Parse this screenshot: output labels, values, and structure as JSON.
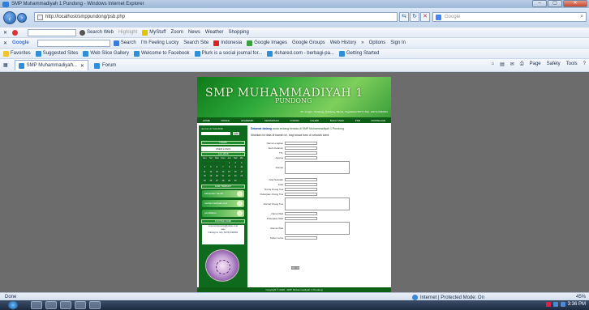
{
  "window": {
    "title": "SMP Muhammadiyah 1 Pundong - Windows Internet Explorer",
    "buttons": [
      "–",
      "▢",
      "✕"
    ]
  },
  "address": {
    "url": "http://localhost/smppundong/psb.php",
    "search_placeholder": "Google"
  },
  "toolbar1": {
    "items": [
      "Search Web",
      "Highlight",
      "MyStuff",
      "Zoom",
      "News",
      "Weather",
      "Shopping"
    ]
  },
  "toolbar2": {
    "brand": "Google",
    "items": [
      "Search",
      "I'm Feeling Lucky",
      "Search Site",
      "Indonesia",
      "Google Images",
      "Google Groups",
      "Web History",
      "»",
      "Options",
      "Sign In"
    ]
  },
  "favorites": {
    "label": "Favorites",
    "items": [
      "Suggested Sites",
      "Web Slice Gallery",
      "Welcome to Facebook",
      "Plurk is a social journal for...",
      "4shared.com - berbagi-pa...",
      "Getting Started"
    ]
  },
  "tabs": [
    {
      "label": "SMP Muhammadiyah..."
    },
    {
      "label": "Forum"
    }
  ],
  "commands": [
    "Page",
    "Safety",
    "Tools"
  ],
  "site": {
    "title": "SMP MUHAMMADIYAH 1",
    "subtitle": "PUNDONG",
    "address": "Jln. Imogiri - Pundong, Pundong, Bantul, Yogyakarta 55771 Telp. (0274) 6462301",
    "menu": [
      "HOME",
      "PROFIL",
      "AKADEMIK",
      "KESISWAAN",
      "FORUM",
      "GALERI",
      "BUKU TAMU",
      "PSB",
      "DOWNLOAD"
    ],
    "left": {
      "date": "Jum'at, 27 Juli 2018",
      "go": "GO",
      "login_head": "LOGIN",
      "login_box": "USER LOGIN",
      "calendar_head": "Juni 2018",
      "calendar": [
        "Sen",
        "Sel",
        "Rab",
        "Kam",
        "Jum",
        "Sab",
        "Min",
        "",
        "",
        "",
        "",
        "1",
        "2",
        "3",
        "4",
        "5",
        "6",
        "7",
        "8",
        "9",
        "10",
        "11",
        "12",
        "13",
        "14",
        "15",
        "16",
        "17",
        "18",
        "19",
        "20",
        "21",
        "22",
        "23",
        "24",
        "25",
        "26",
        "27",
        "28",
        "29",
        "30"
      ],
      "links_head": "LINK TERKAIT",
      "banners": [
        "kabupaten bantul",
        "muhammadiyah.or.id",
        "pendidikan"
      ],
      "contact_head": "KONTAK KAMI",
      "contact_lines": [
        "smpmuh1pundong@yahoo.co.id",
        "atau",
        "hubungi no. telp. (0274) 6462301"
      ]
    },
    "content": {
      "welcome_prefix": "Selamat datang",
      "welcome_rest": "anda sedang berada di SMP Muhammadiyah 1 Pundong",
      "intro": "Silahkan isi data di bawah ini, bagi siswa baru di sekolah kami",
      "fields": [
        "Nama Lengkap",
        "Jenis Kelamin",
        "TTL",
        "Agama",
        "Alamat",
        "Asal Sekolah",
        "Kota",
        "Nama Orang Tua",
        "Pekerjaan Orang Tua",
        "Alamat Orang Tua",
        "Nama Wali",
        "Pekerjaan Wali",
        "Alamat Wali",
        "Tahun Lulus"
      ],
      "submit": "KIRIM"
    },
    "footer": "Copyright © 2018 - SMP Muhammadiyah 1 Pundong"
  },
  "status": {
    "done": "Done",
    "zone": "Internet | Protected Mode: On",
    "zoom": "45%"
  },
  "taskbar": {
    "time": "3:36 PM"
  }
}
